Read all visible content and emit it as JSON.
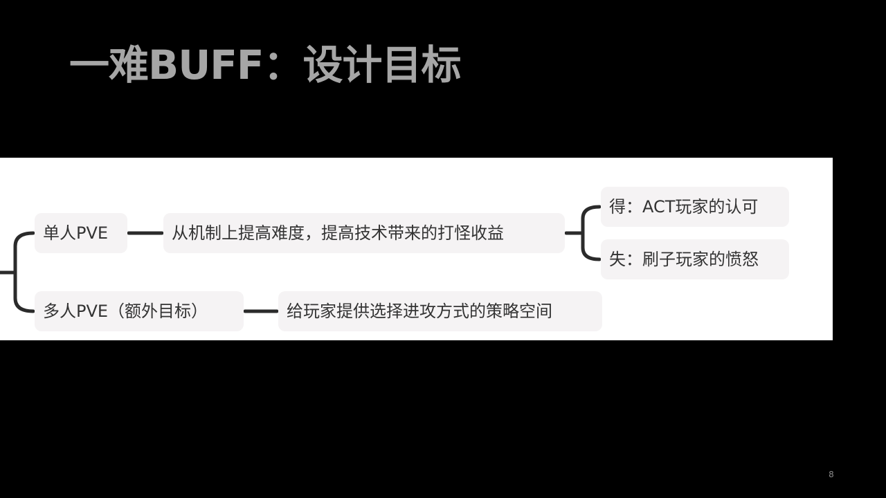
{
  "slide": {
    "title": "一难BUFF：设计目标",
    "page_number": "8"
  },
  "mindmap": {
    "branches": [
      {
        "label": "单人PVE",
        "goal": "从机制上提高难度，提高技术带来的打怪收益",
        "outcomes": [
          "得：ACT玩家的认可",
          "失：刷子玩家的愤怒"
        ]
      },
      {
        "label": "多人PVE（额外目标）",
        "goal": "给玩家提供选择进攻方式的策略空间"
      }
    ]
  },
  "colors": {
    "background": "#000000",
    "title_text": "#a6a6a6",
    "panel": "#ffffff",
    "node_fill": "#f5f3f4",
    "node_text": "#333333",
    "connector": "#2b2b2b"
  }
}
